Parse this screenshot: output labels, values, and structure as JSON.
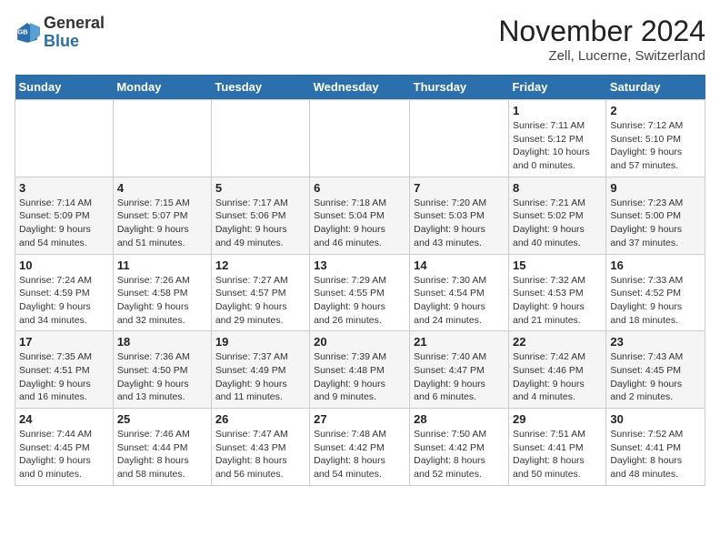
{
  "logo": {
    "general": "General",
    "blue": "Blue"
  },
  "title": "November 2024",
  "location": "Zell, Lucerne, Switzerland",
  "days_of_week": [
    "Sunday",
    "Monday",
    "Tuesday",
    "Wednesday",
    "Thursday",
    "Friday",
    "Saturday"
  ],
  "weeks": [
    [
      {
        "day": "",
        "info": ""
      },
      {
        "day": "",
        "info": ""
      },
      {
        "day": "",
        "info": ""
      },
      {
        "day": "",
        "info": ""
      },
      {
        "day": "",
        "info": ""
      },
      {
        "day": "1",
        "info": "Sunrise: 7:11 AM\nSunset: 5:12 PM\nDaylight: 10 hours\nand 0 minutes."
      },
      {
        "day": "2",
        "info": "Sunrise: 7:12 AM\nSunset: 5:10 PM\nDaylight: 9 hours\nand 57 minutes."
      }
    ],
    [
      {
        "day": "3",
        "info": "Sunrise: 7:14 AM\nSunset: 5:09 PM\nDaylight: 9 hours\nand 54 minutes."
      },
      {
        "day": "4",
        "info": "Sunrise: 7:15 AM\nSunset: 5:07 PM\nDaylight: 9 hours\nand 51 minutes."
      },
      {
        "day": "5",
        "info": "Sunrise: 7:17 AM\nSunset: 5:06 PM\nDaylight: 9 hours\nand 49 minutes."
      },
      {
        "day": "6",
        "info": "Sunrise: 7:18 AM\nSunset: 5:04 PM\nDaylight: 9 hours\nand 46 minutes."
      },
      {
        "day": "7",
        "info": "Sunrise: 7:20 AM\nSunset: 5:03 PM\nDaylight: 9 hours\nand 43 minutes."
      },
      {
        "day": "8",
        "info": "Sunrise: 7:21 AM\nSunset: 5:02 PM\nDaylight: 9 hours\nand 40 minutes."
      },
      {
        "day": "9",
        "info": "Sunrise: 7:23 AM\nSunset: 5:00 PM\nDaylight: 9 hours\nand 37 minutes."
      }
    ],
    [
      {
        "day": "10",
        "info": "Sunrise: 7:24 AM\nSunset: 4:59 PM\nDaylight: 9 hours\nand 34 minutes."
      },
      {
        "day": "11",
        "info": "Sunrise: 7:26 AM\nSunset: 4:58 PM\nDaylight: 9 hours\nand 32 minutes."
      },
      {
        "day": "12",
        "info": "Sunrise: 7:27 AM\nSunset: 4:57 PM\nDaylight: 9 hours\nand 29 minutes."
      },
      {
        "day": "13",
        "info": "Sunrise: 7:29 AM\nSunset: 4:55 PM\nDaylight: 9 hours\nand 26 minutes."
      },
      {
        "day": "14",
        "info": "Sunrise: 7:30 AM\nSunset: 4:54 PM\nDaylight: 9 hours\nand 24 minutes."
      },
      {
        "day": "15",
        "info": "Sunrise: 7:32 AM\nSunset: 4:53 PM\nDaylight: 9 hours\nand 21 minutes."
      },
      {
        "day": "16",
        "info": "Sunrise: 7:33 AM\nSunset: 4:52 PM\nDaylight: 9 hours\nand 18 minutes."
      }
    ],
    [
      {
        "day": "17",
        "info": "Sunrise: 7:35 AM\nSunset: 4:51 PM\nDaylight: 9 hours\nand 16 minutes."
      },
      {
        "day": "18",
        "info": "Sunrise: 7:36 AM\nSunset: 4:50 PM\nDaylight: 9 hours\nand 13 minutes."
      },
      {
        "day": "19",
        "info": "Sunrise: 7:37 AM\nSunset: 4:49 PM\nDaylight: 9 hours\nand 11 minutes."
      },
      {
        "day": "20",
        "info": "Sunrise: 7:39 AM\nSunset: 4:48 PM\nDaylight: 9 hours\nand 9 minutes."
      },
      {
        "day": "21",
        "info": "Sunrise: 7:40 AM\nSunset: 4:47 PM\nDaylight: 9 hours\nand 6 minutes."
      },
      {
        "day": "22",
        "info": "Sunrise: 7:42 AM\nSunset: 4:46 PM\nDaylight: 9 hours\nand 4 minutes."
      },
      {
        "day": "23",
        "info": "Sunrise: 7:43 AM\nSunset: 4:45 PM\nDaylight: 9 hours\nand 2 minutes."
      }
    ],
    [
      {
        "day": "24",
        "info": "Sunrise: 7:44 AM\nSunset: 4:45 PM\nDaylight: 9 hours\nand 0 minutes."
      },
      {
        "day": "25",
        "info": "Sunrise: 7:46 AM\nSunset: 4:44 PM\nDaylight: 8 hours\nand 58 minutes."
      },
      {
        "day": "26",
        "info": "Sunrise: 7:47 AM\nSunset: 4:43 PM\nDaylight: 8 hours\nand 56 minutes."
      },
      {
        "day": "27",
        "info": "Sunrise: 7:48 AM\nSunset: 4:42 PM\nDaylight: 8 hours\nand 54 minutes."
      },
      {
        "day": "28",
        "info": "Sunrise: 7:50 AM\nSunset: 4:42 PM\nDaylight: 8 hours\nand 52 minutes."
      },
      {
        "day": "29",
        "info": "Sunrise: 7:51 AM\nSunset: 4:41 PM\nDaylight: 8 hours\nand 50 minutes."
      },
      {
        "day": "30",
        "info": "Sunrise: 7:52 AM\nSunset: 4:41 PM\nDaylight: 8 hours\nand 48 minutes."
      }
    ]
  ]
}
